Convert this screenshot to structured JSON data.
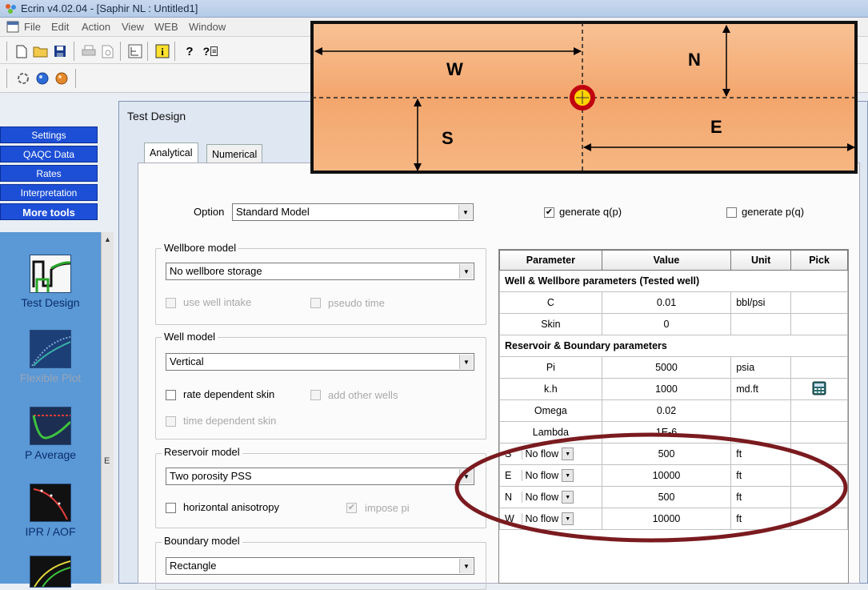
{
  "window": {
    "title": "Ecrin  v4.02.04 - [Saphir NL : Untitled1]"
  },
  "menu": [
    "File",
    "Edit",
    "Action",
    "View",
    "WEB",
    "Window"
  ],
  "toolbar": {
    "help_q": "?",
    "help_q2": "?"
  },
  "sidebar": {
    "tabs": [
      "Settings",
      "QAQC Data",
      "Rates",
      "Interpretation",
      "More tools"
    ],
    "tools": [
      {
        "label": "Test Design",
        "enabled": true
      },
      {
        "label": "Flexible Plot",
        "enabled": false
      },
      {
        "label": "P Average",
        "enabled": true
      },
      {
        "label": "IPR / AOF",
        "enabled": true
      }
    ],
    "scroll_marker": "E"
  },
  "dialog": {
    "title": "Test Design",
    "tabs": [
      "Analytical",
      "Numerical"
    ],
    "option_label": "Option",
    "option_value": "Standard Model",
    "generate_qp": {
      "label": "generate q(p)",
      "checked": true
    },
    "generate_pq": {
      "label": "generate p(q)",
      "checked": false
    },
    "wellbore": {
      "title": "Wellbore model",
      "value": "No wellbore storage",
      "use_well_intake": "use well intake",
      "pseudo_time": "pseudo time"
    },
    "well": {
      "title": "Well model",
      "value": "Vertical",
      "rate_dependent_skin": "rate dependent skin",
      "add_other_wells": "add other wells",
      "time_dependent_skin": "time dependent skin"
    },
    "reservoir": {
      "title": "Reservoir model",
      "value": "Two porosity PSS",
      "horizontal_anisotropy": "horizontal anisotropy",
      "impose_pi": "impose pi"
    },
    "boundary": {
      "title": "Boundary model",
      "value": "Rectangle"
    },
    "table": {
      "headers": [
        "Parameter",
        "Value",
        "Unit",
        "Pick"
      ],
      "section1": "Well & Wellbore parameters (Tested well)",
      "section2": "Reservoir & Boundary parameters",
      "rows1": [
        {
          "param": "C",
          "value": "0.01",
          "unit": "bbl/psi"
        },
        {
          "param": "Skin",
          "value": "0",
          "unit": ""
        }
      ],
      "rows2": [
        {
          "param": "Pi",
          "value": "5000",
          "unit": "psia"
        },
        {
          "param": "k.h",
          "value": "1000",
          "unit": "md.ft"
        },
        {
          "param": "Omega",
          "value": "0.02",
          "unit": ""
        },
        {
          "param": "Lambda",
          "value": "1E-6",
          "unit": ""
        }
      ],
      "boundaries": [
        {
          "side": "S",
          "type": "No flow",
          "value": "500",
          "unit": "ft"
        },
        {
          "side": "E",
          "type": "No flow",
          "value": "10000",
          "unit": "ft"
        },
        {
          "side": "N",
          "type": "No flow",
          "value": "500",
          "unit": "ft"
        },
        {
          "side": "W",
          "type": "No flow",
          "value": "10000",
          "unit": "ft"
        }
      ]
    }
  },
  "diagram": {
    "labels": {
      "W": "W",
      "N": "N",
      "S": "S",
      "E": "E"
    },
    "colors": {
      "fill_top": "#f6b27d",
      "fill_mid": "#f3a36b",
      "well_ring": "#c0000f",
      "well_center": "#ffd500",
      "ellipse": "#7a1b1f"
    }
  }
}
